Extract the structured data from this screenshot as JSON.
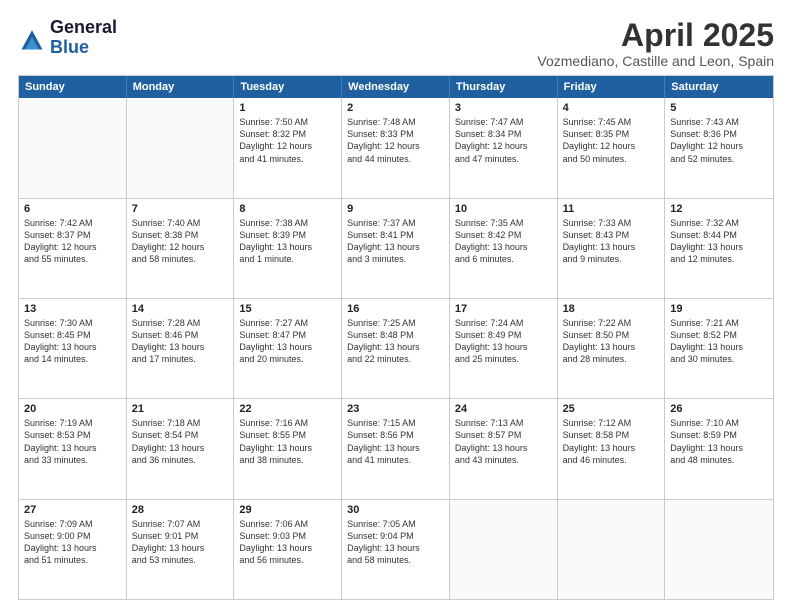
{
  "logo": {
    "general": "General",
    "blue": "Blue"
  },
  "header": {
    "title": "April 2025",
    "location": "Vozmediano, Castille and Leon, Spain"
  },
  "days": [
    "Sunday",
    "Monday",
    "Tuesday",
    "Wednesday",
    "Thursday",
    "Friday",
    "Saturday"
  ],
  "weeks": [
    [
      {
        "day": "",
        "empty": true
      },
      {
        "day": "",
        "empty": true
      },
      {
        "day": "1",
        "line1": "Sunrise: 7:50 AM",
        "line2": "Sunset: 8:32 PM",
        "line3": "Daylight: 12 hours",
        "line4": "and 41 minutes."
      },
      {
        "day": "2",
        "line1": "Sunrise: 7:48 AM",
        "line2": "Sunset: 8:33 PM",
        "line3": "Daylight: 12 hours",
        "line4": "and 44 minutes."
      },
      {
        "day": "3",
        "line1": "Sunrise: 7:47 AM",
        "line2": "Sunset: 8:34 PM",
        "line3": "Daylight: 12 hours",
        "line4": "and 47 minutes."
      },
      {
        "day": "4",
        "line1": "Sunrise: 7:45 AM",
        "line2": "Sunset: 8:35 PM",
        "line3": "Daylight: 12 hours",
        "line4": "and 50 minutes."
      },
      {
        "day": "5",
        "line1": "Sunrise: 7:43 AM",
        "line2": "Sunset: 8:36 PM",
        "line3": "Daylight: 12 hours",
        "line4": "and 52 minutes."
      }
    ],
    [
      {
        "day": "6",
        "line1": "Sunrise: 7:42 AM",
        "line2": "Sunset: 8:37 PM",
        "line3": "Daylight: 12 hours",
        "line4": "and 55 minutes."
      },
      {
        "day": "7",
        "line1": "Sunrise: 7:40 AM",
        "line2": "Sunset: 8:38 PM",
        "line3": "Daylight: 12 hours",
        "line4": "and 58 minutes."
      },
      {
        "day": "8",
        "line1": "Sunrise: 7:38 AM",
        "line2": "Sunset: 8:39 PM",
        "line3": "Daylight: 13 hours",
        "line4": "and 1 minute."
      },
      {
        "day": "9",
        "line1": "Sunrise: 7:37 AM",
        "line2": "Sunset: 8:41 PM",
        "line3": "Daylight: 13 hours",
        "line4": "and 3 minutes."
      },
      {
        "day": "10",
        "line1": "Sunrise: 7:35 AM",
        "line2": "Sunset: 8:42 PM",
        "line3": "Daylight: 13 hours",
        "line4": "and 6 minutes."
      },
      {
        "day": "11",
        "line1": "Sunrise: 7:33 AM",
        "line2": "Sunset: 8:43 PM",
        "line3": "Daylight: 13 hours",
        "line4": "and 9 minutes."
      },
      {
        "day": "12",
        "line1": "Sunrise: 7:32 AM",
        "line2": "Sunset: 8:44 PM",
        "line3": "Daylight: 13 hours",
        "line4": "and 12 minutes."
      }
    ],
    [
      {
        "day": "13",
        "line1": "Sunrise: 7:30 AM",
        "line2": "Sunset: 8:45 PM",
        "line3": "Daylight: 13 hours",
        "line4": "and 14 minutes."
      },
      {
        "day": "14",
        "line1": "Sunrise: 7:28 AM",
        "line2": "Sunset: 8:46 PM",
        "line3": "Daylight: 13 hours",
        "line4": "and 17 minutes."
      },
      {
        "day": "15",
        "line1": "Sunrise: 7:27 AM",
        "line2": "Sunset: 8:47 PM",
        "line3": "Daylight: 13 hours",
        "line4": "and 20 minutes."
      },
      {
        "day": "16",
        "line1": "Sunrise: 7:25 AM",
        "line2": "Sunset: 8:48 PM",
        "line3": "Daylight: 13 hours",
        "line4": "and 22 minutes."
      },
      {
        "day": "17",
        "line1": "Sunrise: 7:24 AM",
        "line2": "Sunset: 8:49 PM",
        "line3": "Daylight: 13 hours",
        "line4": "and 25 minutes."
      },
      {
        "day": "18",
        "line1": "Sunrise: 7:22 AM",
        "line2": "Sunset: 8:50 PM",
        "line3": "Daylight: 13 hours",
        "line4": "and 28 minutes."
      },
      {
        "day": "19",
        "line1": "Sunrise: 7:21 AM",
        "line2": "Sunset: 8:52 PM",
        "line3": "Daylight: 13 hours",
        "line4": "and 30 minutes."
      }
    ],
    [
      {
        "day": "20",
        "line1": "Sunrise: 7:19 AM",
        "line2": "Sunset: 8:53 PM",
        "line3": "Daylight: 13 hours",
        "line4": "and 33 minutes."
      },
      {
        "day": "21",
        "line1": "Sunrise: 7:18 AM",
        "line2": "Sunset: 8:54 PM",
        "line3": "Daylight: 13 hours",
        "line4": "and 36 minutes."
      },
      {
        "day": "22",
        "line1": "Sunrise: 7:16 AM",
        "line2": "Sunset: 8:55 PM",
        "line3": "Daylight: 13 hours",
        "line4": "and 38 minutes."
      },
      {
        "day": "23",
        "line1": "Sunrise: 7:15 AM",
        "line2": "Sunset: 8:56 PM",
        "line3": "Daylight: 13 hours",
        "line4": "and 41 minutes."
      },
      {
        "day": "24",
        "line1": "Sunrise: 7:13 AM",
        "line2": "Sunset: 8:57 PM",
        "line3": "Daylight: 13 hours",
        "line4": "and 43 minutes."
      },
      {
        "day": "25",
        "line1": "Sunrise: 7:12 AM",
        "line2": "Sunset: 8:58 PM",
        "line3": "Daylight: 13 hours",
        "line4": "and 46 minutes."
      },
      {
        "day": "26",
        "line1": "Sunrise: 7:10 AM",
        "line2": "Sunset: 8:59 PM",
        "line3": "Daylight: 13 hours",
        "line4": "and 48 minutes."
      }
    ],
    [
      {
        "day": "27",
        "line1": "Sunrise: 7:09 AM",
        "line2": "Sunset: 9:00 PM",
        "line3": "Daylight: 13 hours",
        "line4": "and 51 minutes."
      },
      {
        "day": "28",
        "line1": "Sunrise: 7:07 AM",
        "line2": "Sunset: 9:01 PM",
        "line3": "Daylight: 13 hours",
        "line4": "and 53 minutes."
      },
      {
        "day": "29",
        "line1": "Sunrise: 7:06 AM",
        "line2": "Sunset: 9:03 PM",
        "line3": "Daylight: 13 hours",
        "line4": "and 56 minutes."
      },
      {
        "day": "30",
        "line1": "Sunrise: 7:05 AM",
        "line2": "Sunset: 9:04 PM",
        "line3": "Daylight: 13 hours",
        "line4": "and 58 minutes."
      },
      {
        "day": "",
        "empty": true
      },
      {
        "day": "",
        "empty": true
      },
      {
        "day": "",
        "empty": true
      }
    ]
  ]
}
